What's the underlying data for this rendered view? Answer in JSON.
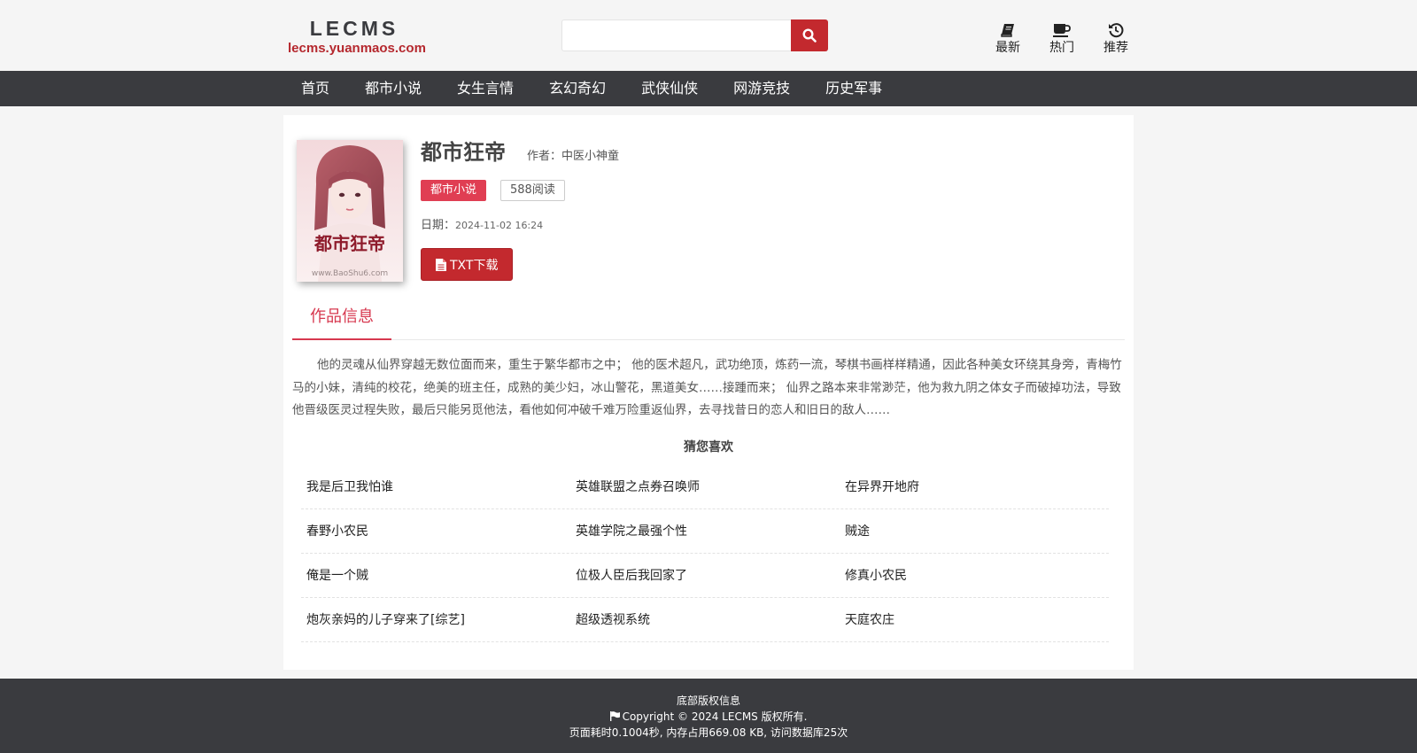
{
  "site": {
    "logo_title": "LECMS",
    "logo_sub": "lecms.yuanmaos.com"
  },
  "search": {
    "value": "",
    "placeholder": ""
  },
  "quick_links": [
    {
      "label": "最新",
      "icon": "book-icon"
    },
    {
      "label": "热门",
      "icon": "coffee-icon"
    },
    {
      "label": "推荐",
      "icon": "history-icon"
    }
  ],
  "nav": [
    "首页",
    "都市小说",
    "女生言情",
    "玄幻奇幻",
    "武侠仙侠",
    "网游竞技",
    "历史军事"
  ],
  "book": {
    "title": "都市狂帝",
    "author_label": "作者：",
    "author": "中医小神童",
    "category": "都市小说",
    "reads": "588阅读",
    "date_label": "日期：",
    "date": "2024-11-02 16:24",
    "download_label": "TXT下载",
    "cover_title": "都市狂帝",
    "cover_watermark": "www.BaoShu6.com"
  },
  "tab_label": "作品信息",
  "description": "他的灵魂从仙界穿越无数位面而来，重生于繁华都市之中； 他的医术超凡，武功绝顶，炼药一流，琴棋书画样样精通，因此各种美女环绕其身旁，青梅竹马的小妹，清纯的校花，绝美的班主任，成熟的美少妇，冰山警花，黑道美女……接踵而来； 仙界之路本来非常渺茫，他为救九阴之体女子而破掉功法，导致他晋级医灵过程失败，最后只能另觅他法，看他如何冲破千难万险重返仙界，去寻找昔日的恋人和旧日的敌人……",
  "recommend": {
    "title": "猜您喜欢",
    "items": [
      [
        "我是后卫我怕谁",
        "英雄联盟之点券召唤师",
        "在异界开地府"
      ],
      [
        "春野小农民",
        "英雄学院之最强个性",
        "贼途"
      ],
      [
        "俺是一个贼",
        "位极人臣后我回家了",
        "修真小农民"
      ],
      [
        "炮灰亲妈的儿子穿来了[综艺]",
        "超级透视系统",
        "天庭农庄"
      ]
    ]
  },
  "footer": {
    "line1": "底部版权信息",
    "line2": "Copyright © 2024 LECMS 版权所有.",
    "line3": "页面耗时0.1004秒, 内存占用669.08 KB, 访问数据库25次"
  },
  "colors": {
    "brand_red": "#c3292e",
    "tab_pink": "#d7384f",
    "nav_bg": "#3a3b3f"
  }
}
